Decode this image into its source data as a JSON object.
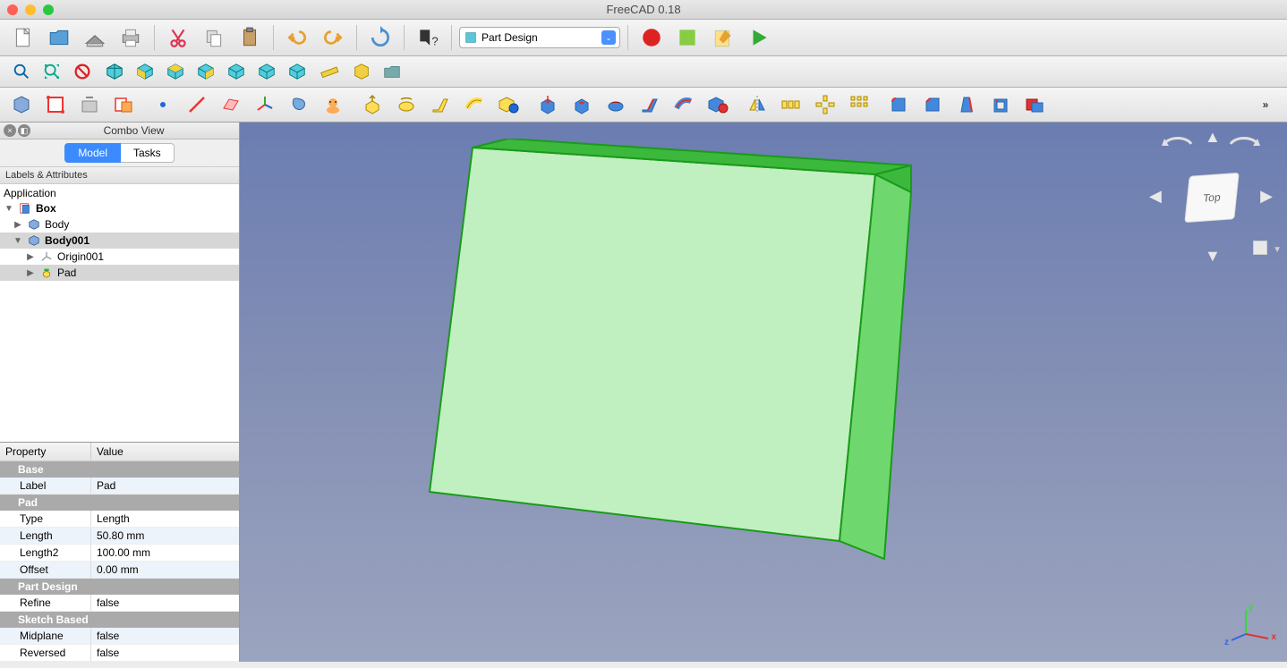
{
  "app": {
    "title": "FreeCAD 0.18"
  },
  "workbench": {
    "selected": "Part Design"
  },
  "comboView": {
    "title": "Combo View",
    "tabs": {
      "model": "Model",
      "tasks": "Tasks"
    },
    "labelsHeader": "Labels & Attributes",
    "tree": {
      "root": "Application",
      "doc": "Box",
      "body1": "Body",
      "body2": "Body001",
      "origin": "Origin001",
      "pad": "Pad"
    }
  },
  "properties": {
    "headerProperty": "Property",
    "headerValue": "Value",
    "sections": {
      "base": "Base",
      "pad": "Pad",
      "partDesign": "Part Design",
      "sketchBased": "Sketch Based"
    },
    "rows": {
      "label": {
        "name": "Label",
        "value": "Pad"
      },
      "type": {
        "name": "Type",
        "value": "Length"
      },
      "length": {
        "name": "Length",
        "value": "50.80 mm"
      },
      "length2": {
        "name": "Length2",
        "value": "100.00 mm"
      },
      "offset": {
        "name": "Offset",
        "value": "0.00 mm"
      },
      "refine": {
        "name": "Refine",
        "value": "false"
      },
      "midplane": {
        "name": "Midplane",
        "value": "false"
      },
      "reversed": {
        "name": "Reversed",
        "value": "false"
      }
    }
  },
  "navCube": {
    "face": "Top"
  },
  "axes": {
    "x": "x",
    "y": "y",
    "z": "z"
  }
}
